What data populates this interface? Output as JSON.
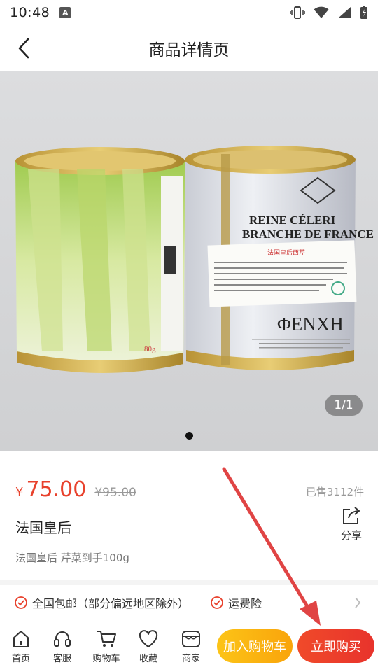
{
  "status": {
    "time": "10:48",
    "badge": "A"
  },
  "header": {
    "title": "商品详情页"
  },
  "gallery": {
    "counter": "1/1"
  },
  "product": {
    "currency": "¥",
    "price": "75.00",
    "original_price": "¥95.00",
    "sold": "已售3112件",
    "name": "法国皇后",
    "subtitle": "法国皇后 芹菜到手100g",
    "share_label": "分享"
  },
  "can_right": {
    "title_line1": "REINE CÉLERI",
    "title_line2": "BRANCHE DE FRANCE",
    "brand": "ΦENXH",
    "label_cn": "法国皇后西芹"
  },
  "can_left": {
    "weight": "80g"
  },
  "services": [
    "全国包邮（部分偏远地区除外）",
    "运费险"
  ],
  "nav": [
    "首页",
    "客服",
    "购物车",
    "收藏",
    "商家"
  ],
  "actions": {
    "add_to_cart": "加入购物车",
    "buy_now": "立即购买"
  },
  "colors": {
    "accent": "#e8412c",
    "cart_button": "#f9a40b",
    "buy_button": "#e8332c",
    "arrow": "#e04444"
  }
}
